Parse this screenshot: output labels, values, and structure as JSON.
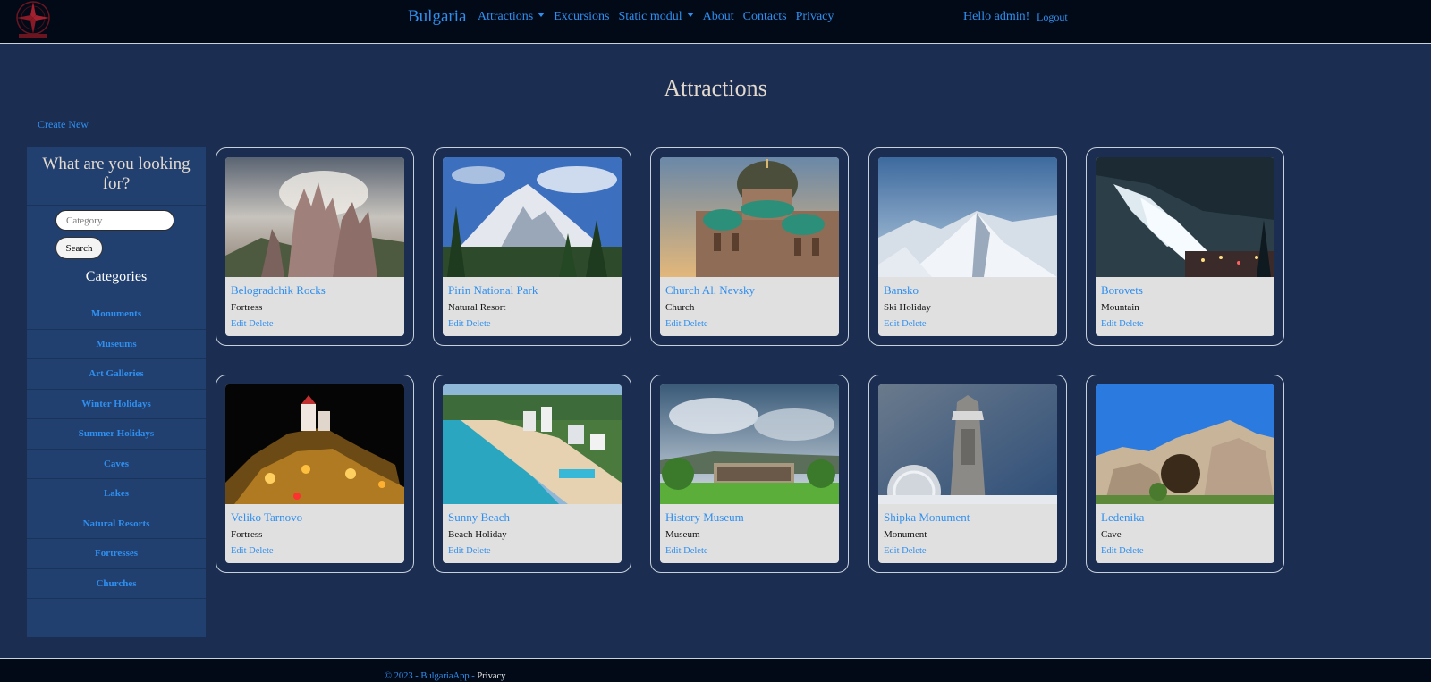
{
  "nav": {
    "brand": "Bulgaria",
    "links": [
      "Attractions",
      "Excursions",
      "Static modul",
      "About",
      "Contacts",
      "Privacy"
    ],
    "greeting": "Hello admin!",
    "logout": "Logout"
  },
  "main": {
    "title": "Attractions",
    "create_new": "Create New"
  },
  "sidebar": {
    "question": "What are you looking for?",
    "search_placeholder": "Category",
    "search_button": "Search",
    "categories_title": "Categories",
    "categories": [
      "Monuments",
      "Museums",
      "Art Galleries",
      "Winter Holidays",
      "Summer Holidays",
      "Caves",
      "Lakes",
      "Natural Resorts",
      "Fortresses",
      "Churches"
    ]
  },
  "cards": [
    {
      "name": "Belogradchik Rocks",
      "category": "Fortress",
      "edit": "Edit",
      "delete": "Delete",
      "icon": "rock-landscape-image"
    },
    {
      "name": "Pirin National Park",
      "category": "Natural Resort",
      "edit": "Edit",
      "delete": "Delete",
      "icon": "mountain-forest-image"
    },
    {
      "name": "Church Al. Nevsky",
      "category": "Church",
      "edit": "Edit",
      "delete": "Delete",
      "icon": "cathedral-image"
    },
    {
      "name": "Bansko",
      "category": "Ski Holiday",
      "edit": "Edit",
      "delete": "Delete",
      "icon": "snowy-mountains-image"
    },
    {
      "name": "Borovets",
      "category": "Mountain",
      "edit": "Edit",
      "delete": "Delete",
      "icon": "night-ski-slope-image"
    },
    {
      "name": "Veliko Tarnovo",
      "category": "Fortress",
      "edit": "Edit",
      "delete": "Delete",
      "icon": "lit-fortress-image"
    },
    {
      "name": "Sunny Beach",
      "category": "Beach Holiday",
      "edit": "Edit",
      "delete": "Delete",
      "icon": "beach-resort-image"
    },
    {
      "name": "History Museum",
      "category": "Museum",
      "edit": "Edit",
      "delete": "Delete",
      "icon": "museum-building-image"
    },
    {
      "name": "Shipka Monument",
      "category": "Monument",
      "edit": "Edit",
      "delete": "Delete",
      "icon": "stone-monument-image"
    },
    {
      "name": "Ledenika",
      "category": "Cave",
      "edit": "Edit",
      "delete": "Delete",
      "icon": "cave-rocks-image"
    }
  ],
  "footer": {
    "text": "© 2023 - BulgariaApp - ",
    "privacy": "Privacy"
  }
}
